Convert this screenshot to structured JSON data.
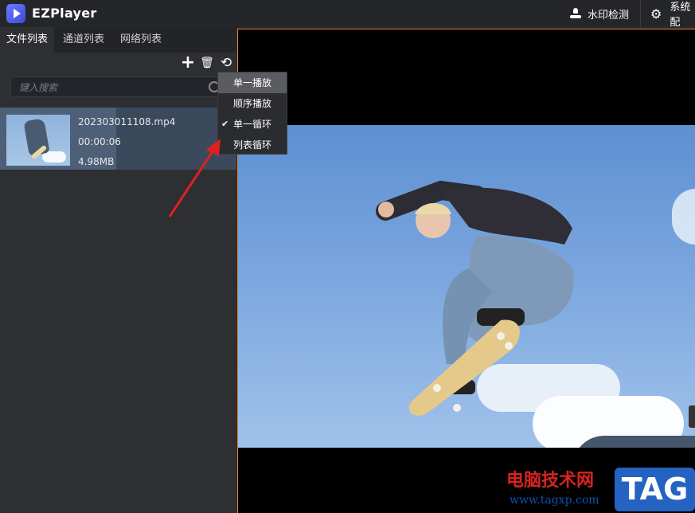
{
  "app": {
    "title": "EZPlayer"
  },
  "titlebar": {
    "watermark_check": "水印检测",
    "settings": "系统配",
    "watermark_icon": "person-icon",
    "settings_icon": "gear-icon"
  },
  "tabs": [
    {
      "label": "文件列表",
      "active": true
    },
    {
      "label": "通道列表",
      "active": false
    },
    {
      "label": "网络列表",
      "active": false
    }
  ],
  "toolbar": {
    "add": "+",
    "delete": "🗑",
    "loop": "⟲"
  },
  "search": {
    "placeholder": "键入搜索"
  },
  "files": [
    {
      "name": "202303011108.mp4",
      "duration": "00:00:06",
      "size": "4.98MB"
    }
  ],
  "play_mode_menu": {
    "items": [
      {
        "label": "单一播放",
        "hover": true,
        "checked": false
      },
      {
        "label": "顺序播放",
        "hover": false,
        "checked": false
      },
      {
        "label": "单一循环",
        "hover": false,
        "checked": true
      },
      {
        "label": "列表循环",
        "hover": false,
        "checked": false
      }
    ],
    "check_mark": "✔"
  },
  "watermark": {
    "cn": "电脑技术网",
    "url": "www.tagxp.com",
    "tag": "TAG"
  },
  "colors": {
    "accent_border": "#d9822b",
    "arrow": "#e02020",
    "selection": "#3a4a5c"
  }
}
